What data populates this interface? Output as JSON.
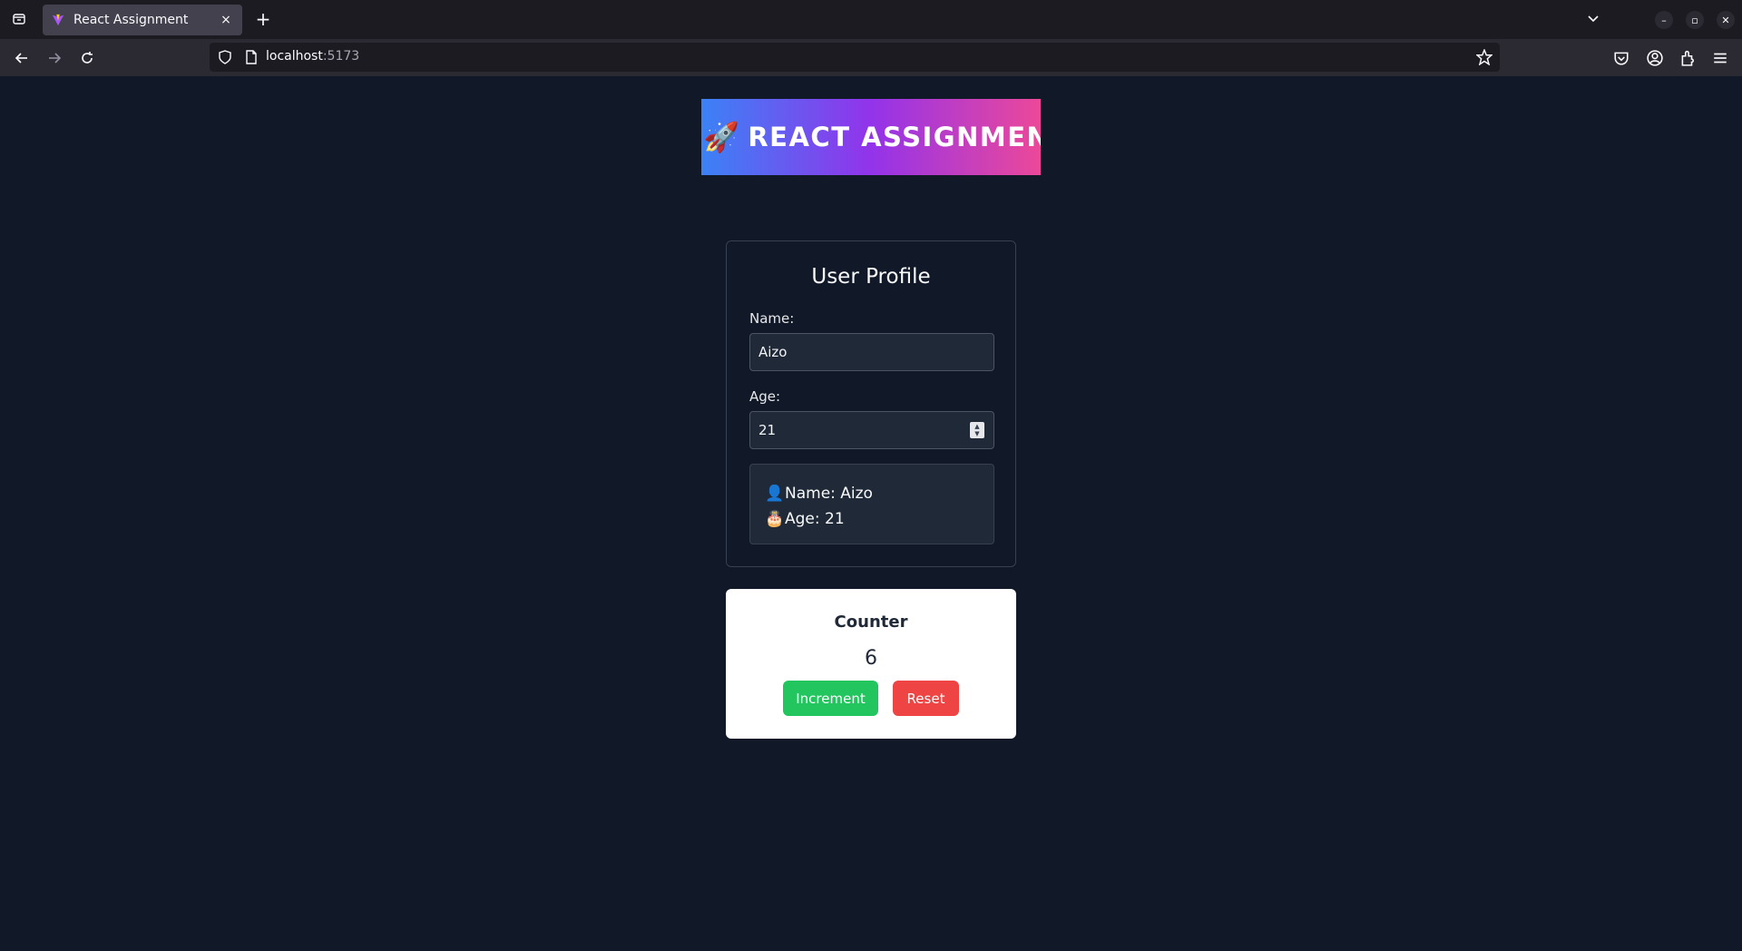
{
  "browser": {
    "tab_title": "React Assignment",
    "tab_close": "×",
    "new_tab": "+",
    "url_host": "localhost",
    "url_port": ":5173",
    "window_controls": {
      "minimize": "–",
      "restore": "▫",
      "close": "✕"
    }
  },
  "banner": {
    "emoji": "🚀",
    "title": "REACT ASSIGNMENT"
  },
  "profile": {
    "title": "User Profile",
    "name_label": "Name:",
    "name_value": "Aizo",
    "age_label": "Age:",
    "age_value": "21",
    "summary": {
      "name_emoji": "👤",
      "name_line": "Name: Aizo",
      "age_emoji": "🎂",
      "age_line": "Age: 21"
    }
  },
  "counter": {
    "title": "Counter",
    "value": "6",
    "increment_label": "Increment",
    "reset_label": "Reset"
  },
  "colors": {
    "page_bg": "#111827",
    "increment": "#22c55e",
    "reset": "#ef4444",
    "banner_gradient": [
      "#3b82f6",
      "#9333ea",
      "#ec4899"
    ]
  }
}
